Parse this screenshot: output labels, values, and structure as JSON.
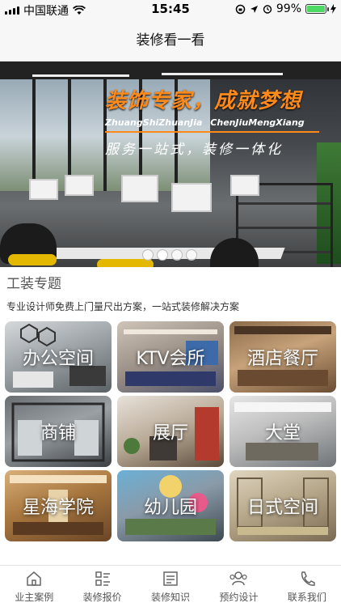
{
  "status_bar": {
    "carrier": "中国联通",
    "time": "15:45",
    "battery_percent": "99%",
    "battery_level": 0.99
  },
  "navbar": {
    "title": "装修看一看"
  },
  "banner": {
    "title": "装饰专家，成就梦想",
    "pinyin": "ZhuangShiZhuanJia  ChenJiuMengXiang",
    "subtitle": "服务一站式，装修一体化",
    "slide_count": 4,
    "active_slide": 1
  },
  "section": {
    "title": "工装专题",
    "description": "专业设计师免费上门量尺出方案，一站式装修解决方案"
  },
  "categories": [
    {
      "label": "办公空间"
    },
    {
      "label": "KTV会所"
    },
    {
      "label": "酒店餐厅"
    },
    {
      "label": "商铺"
    },
    {
      "label": "展厅"
    },
    {
      "label": "大堂"
    },
    {
      "label": "星海学院"
    },
    {
      "label": "幼儿园"
    },
    {
      "label": "日式空间"
    }
  ],
  "tabbar": [
    {
      "label": "业主案例",
      "icon": "home-icon"
    },
    {
      "label": "装修报价",
      "icon": "list-icon"
    },
    {
      "label": "装修知识",
      "icon": "document-icon"
    },
    {
      "label": "预约设计",
      "icon": "people-icon"
    },
    {
      "label": "联系我们",
      "icon": "phone-icon"
    }
  ],
  "colors": {
    "accent": "#ff8a1a",
    "battery": "#4cd964"
  }
}
